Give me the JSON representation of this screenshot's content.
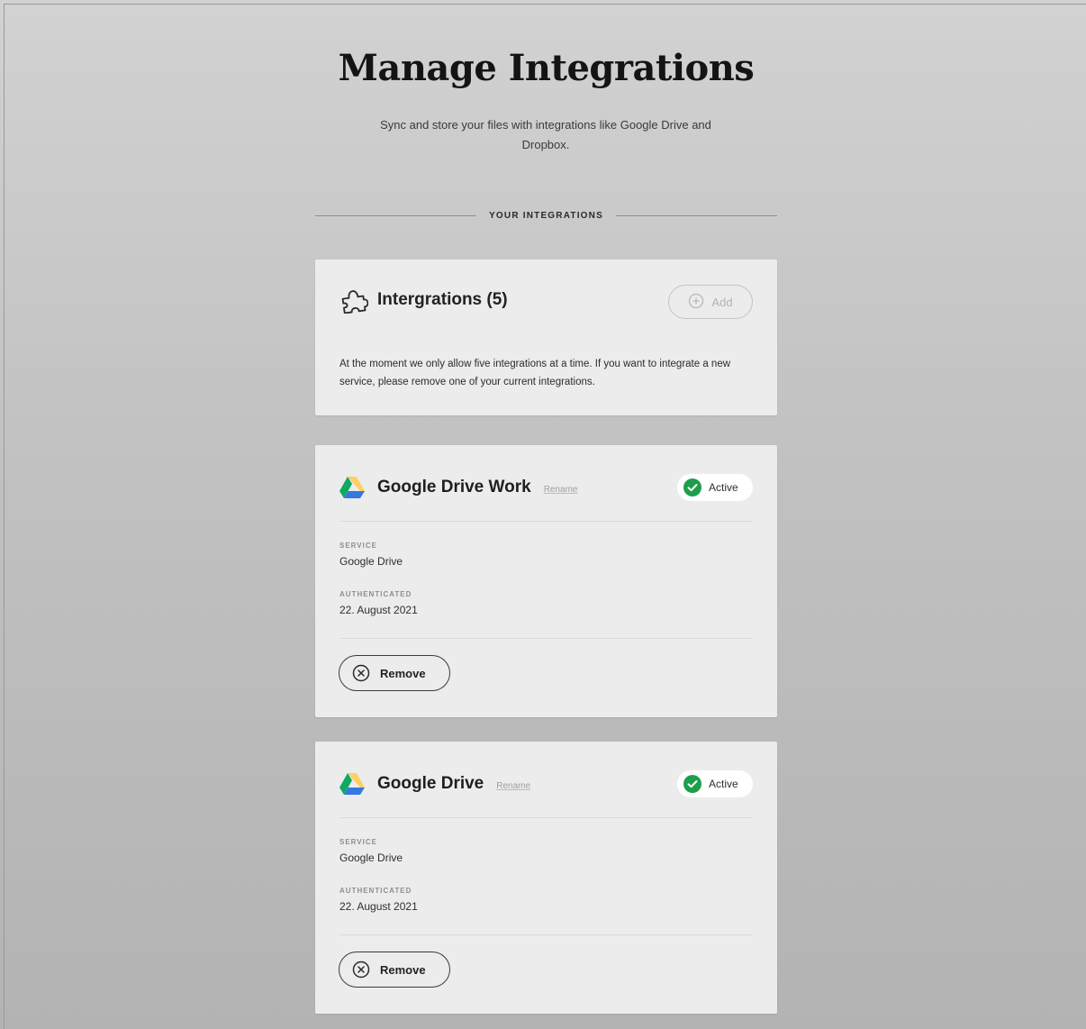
{
  "page": {
    "title": "Manage Integrations",
    "subtitle": "Sync and store your files with integrations like Google Drive and Dropbox.",
    "section_label": "YOUR INTEGRATIONS"
  },
  "summary": {
    "title": "Intergrations (5)",
    "icon": "puzzle-icon",
    "add_label": "Add",
    "add_disabled": true,
    "notice": "At the moment we only allow five integrations at a time. If you want to integrate a new service, please remove one of your current integrations."
  },
  "integrations": [
    {
      "name": "Google Drive Work",
      "icon": "google-drive-icon",
      "rename_label": "Rename",
      "status": "Active",
      "service_label": "SERVICE",
      "service_value": "Google Drive",
      "authenticated_label": "AUTHENTICATED",
      "authenticated_value": "22. August 2021",
      "remove_label": "Remove"
    },
    {
      "name": "Google Drive",
      "icon": "google-drive-icon",
      "rename_label": "Rename",
      "status": "Active",
      "service_label": "SERVICE",
      "service_value": "Google Drive",
      "authenticated_label": "AUTHENTICATED",
      "authenticated_value": "22. August 2021",
      "remove_label": "Remove"
    }
  ],
  "colors": {
    "status_active": "#1e9e4a",
    "card_background": "#ececec",
    "gdrive_blue": "#3777e3",
    "gdrive_green": "#11a861",
    "gdrive_yellow": "#ffcf63"
  }
}
